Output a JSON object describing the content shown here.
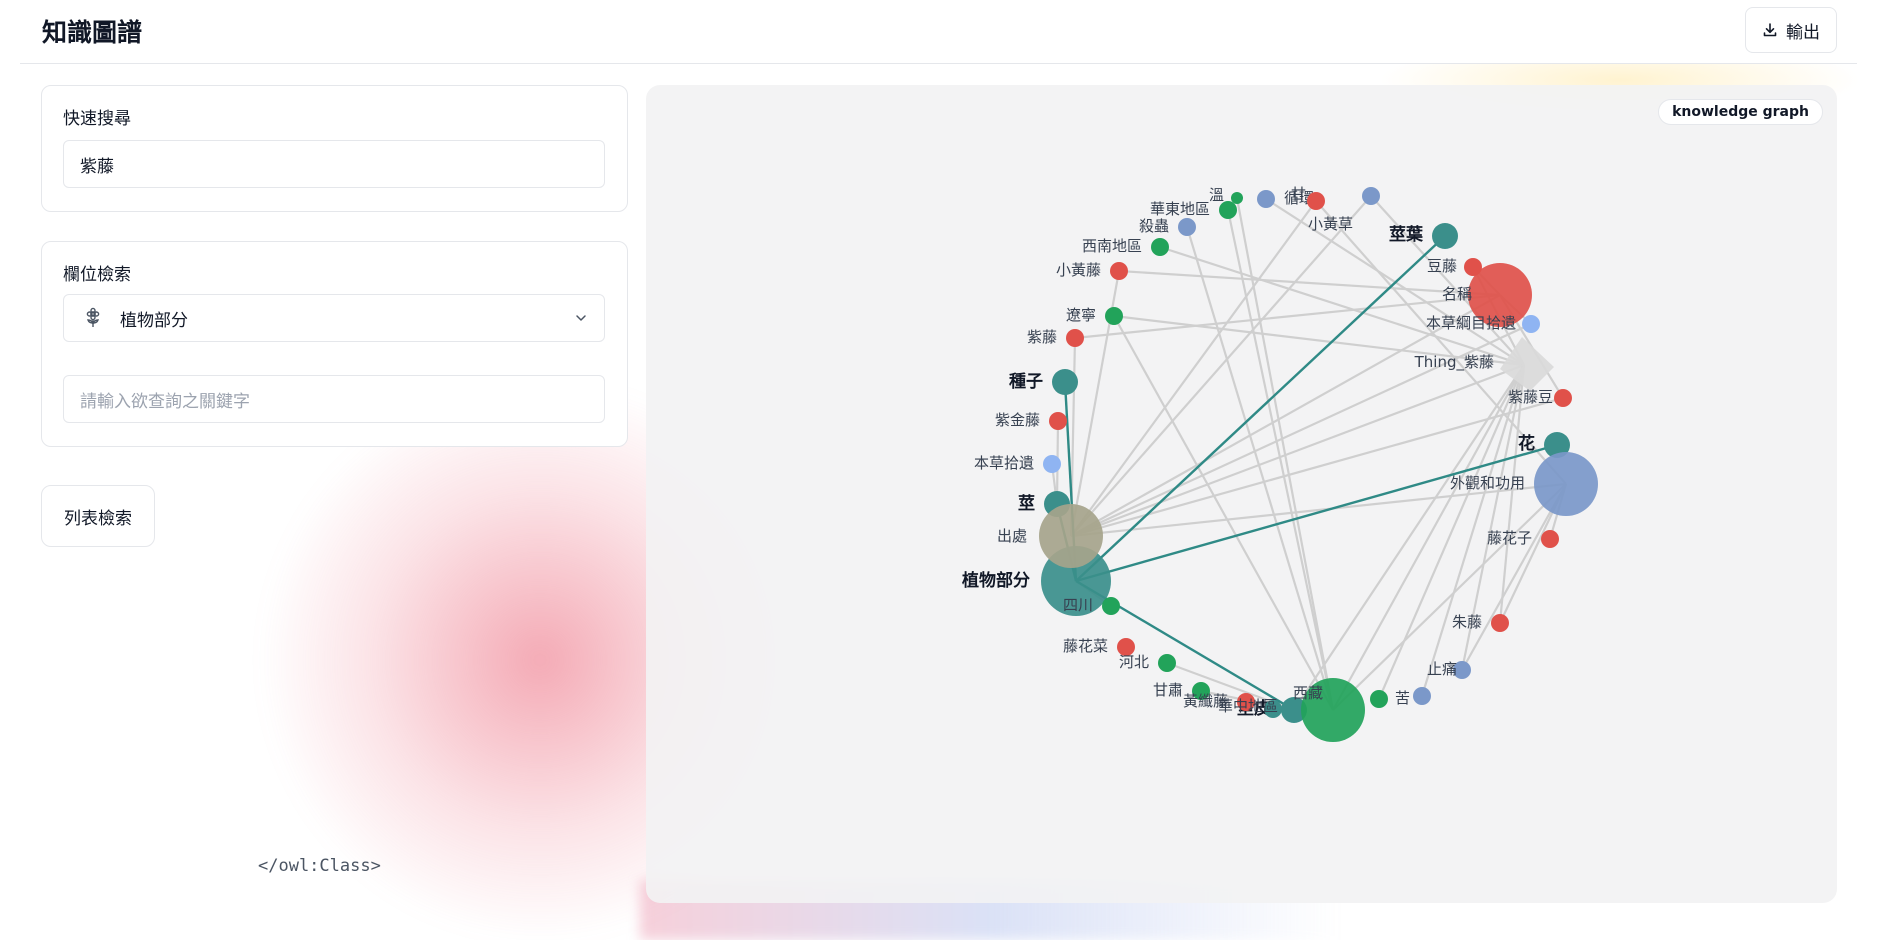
{
  "header": {
    "title": "知識圖譜",
    "export_label": "輸出",
    "export_icon": "download-icon"
  },
  "quick_search": {
    "label": "快速搜尋",
    "value": "紫藤"
  },
  "field_search": {
    "label": "欄位檢索",
    "selected_field": "植物部分",
    "field_icon": "flower-icon",
    "keyword_placeholder": "請輸入欲查詢之關鍵字"
  },
  "list_search": {
    "label": "列表檢索"
  },
  "footer_text": "</owl:Class>",
  "graph": {
    "badge": "knowledge graph",
    "colors": {
      "teal": "#3b8f8b",
      "red": "#e0514a",
      "green": "#22a35a",
      "blue": "#7b98c9",
      "lightblue": "#8fb4f2",
      "olive": "#a6a48b",
      "gray": "#d4d4d4",
      "edge": "#cfcfcf",
      "highlight": "#2f8a86"
    },
    "nodes": [
      {
        "id": "plant_part",
        "label": "植物部分",
        "color": "teal",
        "bold": true
      },
      {
        "id": "seed",
        "label": "種子",
        "color": "teal",
        "bold": true
      },
      {
        "id": "stem",
        "label": "莖",
        "color": "teal",
        "bold": true
      },
      {
        "id": "leaf",
        "label": "莖葉",
        "color": "teal",
        "bold": true
      },
      {
        "id": "flower",
        "label": "花",
        "color": "teal",
        "bold": true
      },
      {
        "id": "bark",
        "label": "莖皮",
        "color": "teal",
        "bold": true
      },
      {
        "id": "origin",
        "label": "出處",
        "color": "olive"
      },
      {
        "id": "name",
        "label": "名稱",
        "color": "red"
      },
      {
        "id": "appearance",
        "label": "外觀和功用",
        "color": "blue"
      },
      {
        "id": "xizang",
        "label": "西藏",
        "color": "green"
      },
      {
        "id": "thing",
        "label": "Thing_紫藤",
        "color": "gray"
      },
      {
        "id": "n1",
        "label": "華東地區",
        "color": "green"
      },
      {
        "id": "n2",
        "label": "溫",
        "color": "green"
      },
      {
        "id": "n3",
        "label": "殺蟲",
        "color": "blue"
      },
      {
        "id": "n4",
        "label": "循環",
        "color": "blue"
      },
      {
        "id": "n5",
        "label": "甘",
        "color": "red"
      },
      {
        "id": "n6",
        "label": "西南地區",
        "color": "green"
      },
      {
        "id": "n7",
        "label": "小黃草",
        "color": "blue"
      },
      {
        "id": "n8",
        "label": "小黃藤",
        "color": "red"
      },
      {
        "id": "n9",
        "label": "豆藤",
        "color": "red"
      },
      {
        "id": "n10",
        "label": "遼寧",
        "color": "green"
      },
      {
        "id": "n11",
        "label": "紫藤",
        "color": "red"
      },
      {
        "id": "n12",
        "label": "本草綱目拾遺",
        "color": "lightblue"
      },
      {
        "id": "n13",
        "label": "紫藤豆",
        "color": "red"
      },
      {
        "id": "n14",
        "label": "紫金藤",
        "color": "red"
      },
      {
        "id": "n15",
        "label": "本草拾遺",
        "color": "lightblue"
      },
      {
        "id": "n16",
        "label": "藤花子",
        "color": "red"
      },
      {
        "id": "n17",
        "label": "四川",
        "color": "green"
      },
      {
        "id": "n18",
        "label": "藤花菜",
        "color": "red"
      },
      {
        "id": "n19",
        "label": "朱藤",
        "color": "red"
      },
      {
        "id": "n20",
        "label": "河北",
        "color": "green"
      },
      {
        "id": "n21",
        "label": "止痛",
        "color": "blue"
      },
      {
        "id": "n22",
        "label": "甘肅",
        "color": "green"
      },
      {
        "id": "n23",
        "label": "黃纖藤",
        "color": "red"
      },
      {
        "id": "n24",
        "label": "苦",
        "color": "green"
      },
      {
        "id": "n25",
        "label": "華中地區",
        "color": "teal"
      },
      {
        "id": "n26",
        "label": "",
        "color": "blue"
      }
    ]
  }
}
